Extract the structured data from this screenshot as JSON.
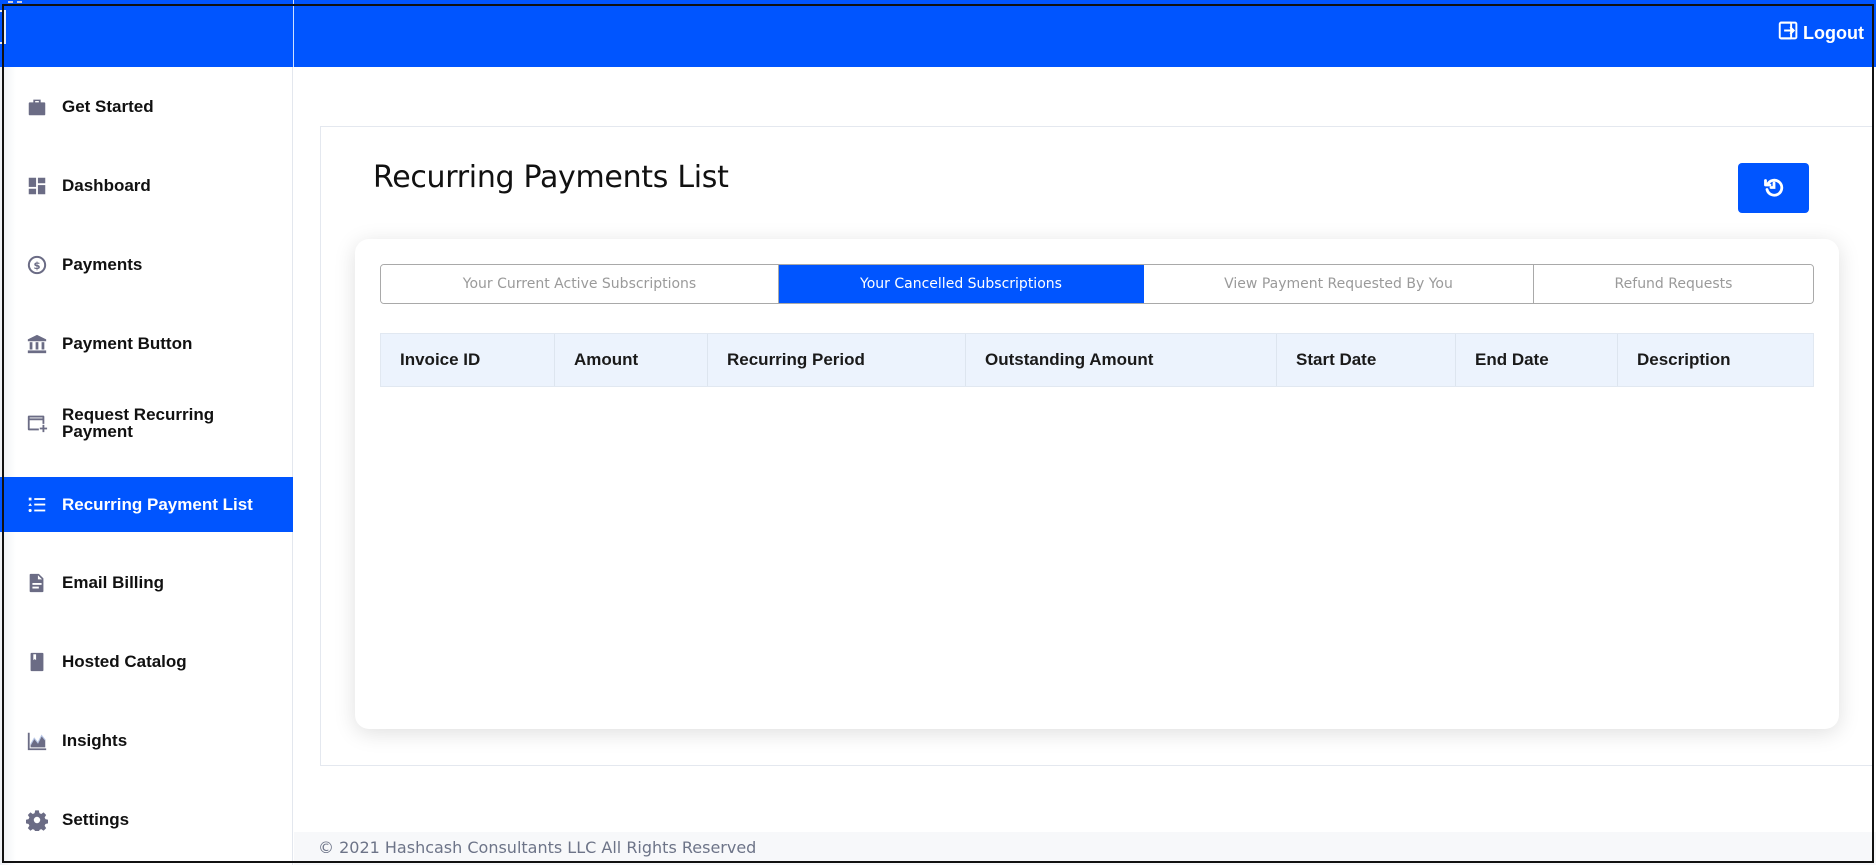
{
  "header": {
    "logout_label": "Logout",
    "accent_color": "#0055ff"
  },
  "sidebar": {
    "items": [
      {
        "label": "Get Started",
        "icon": "briefcase-check-icon",
        "active": false
      },
      {
        "label": "Dashboard",
        "icon": "dashboard-grid-icon",
        "active": false
      },
      {
        "label": "Payments",
        "icon": "dollar-circle-icon",
        "active": false
      },
      {
        "label": "Payment Button",
        "icon": "bank-icon",
        "active": false
      },
      {
        "label": "Request Recurring Payment",
        "icon": "card-plus-icon",
        "active": false
      },
      {
        "label": "Recurring Payment List",
        "icon": "list-icon",
        "active": true
      },
      {
        "label": "Email Billing",
        "icon": "document-icon",
        "active": false
      },
      {
        "label": "Hosted Catalog",
        "icon": "book-icon",
        "active": false
      },
      {
        "label": "Insights",
        "icon": "chart-area-icon",
        "active": false
      },
      {
        "label": "Settings",
        "icon": "gear-icon",
        "active": false
      }
    ]
  },
  "main": {
    "title": "Recurring Payments List",
    "refresh_button_icon": "history-icon",
    "tabs": [
      {
        "label": "Your Current Active Subscriptions",
        "active": false
      },
      {
        "label": "Your Cancelled Subscriptions",
        "active": true
      },
      {
        "label": "View Payment Requested By You",
        "active": false
      },
      {
        "label": "Refund Requests",
        "active": false
      }
    ],
    "table": {
      "columns": [
        "Invoice ID",
        "Amount",
        "Recurring Period",
        "Outstanding Amount",
        "Start Date",
        "End Date",
        "Description"
      ],
      "rows": []
    }
  },
  "footer": {
    "text": "© 2021 Hashcash Consultants LLC All Rights Reserved"
  }
}
